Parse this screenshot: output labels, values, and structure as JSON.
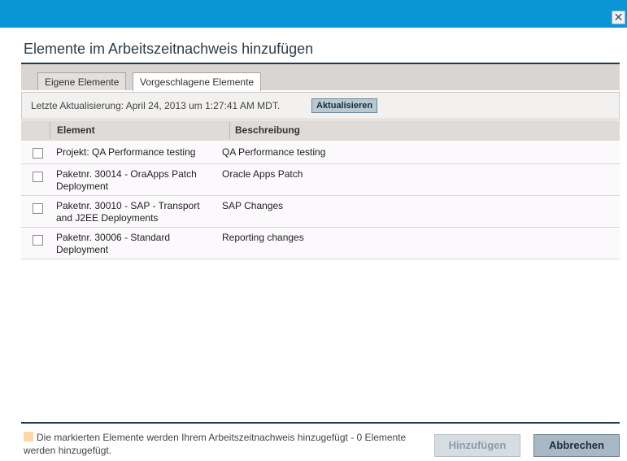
{
  "dialog": {
    "close_glyph": "✕",
    "title": "Elemente im Arbeitszeitnachweis hinzufügen"
  },
  "tabs": [
    {
      "label": "Eigene Elemente",
      "active": false
    },
    {
      "label": "Vorgeschlagene Elemente",
      "active": true
    }
  ],
  "toolbar": {
    "last_update": "Letzte Aktualisierung: April 24, 2013 um 1:27:41 AM MDT.",
    "refresh_label": "Aktualisieren"
  },
  "table": {
    "columns": [
      "Element",
      "Beschreibung"
    ],
    "rows": [
      {
        "element": "Projekt: QA Performance testing",
        "description": "QA Performance testing",
        "checked": false
      },
      {
        "element": "Paketnr. 30014 - OraApps Patch Deployment",
        "description": "Oracle Apps Patch",
        "checked": false
      },
      {
        "element": "Paketnr. 30010 - SAP - Transport and J2EE Deployments",
        "description": "SAP Changes",
        "checked": false
      },
      {
        "element": "Paketnr. 30006 - Standard Deployment",
        "description": "Reporting changes",
        "checked": false
      }
    ]
  },
  "footer": {
    "legend_text": "Die markierten Elemente werden Ihrem Arbeitszeitnachweis hinzugefügt - 0 Elemente werden hinzugefügt.",
    "legend_color": "#fcd8a8",
    "add_label": "Hinzufügen",
    "cancel_label": "Abbrechen"
  },
  "colors": {
    "titlebar": "#0a96d6",
    "heading_rule": "#1f3a55"
  }
}
